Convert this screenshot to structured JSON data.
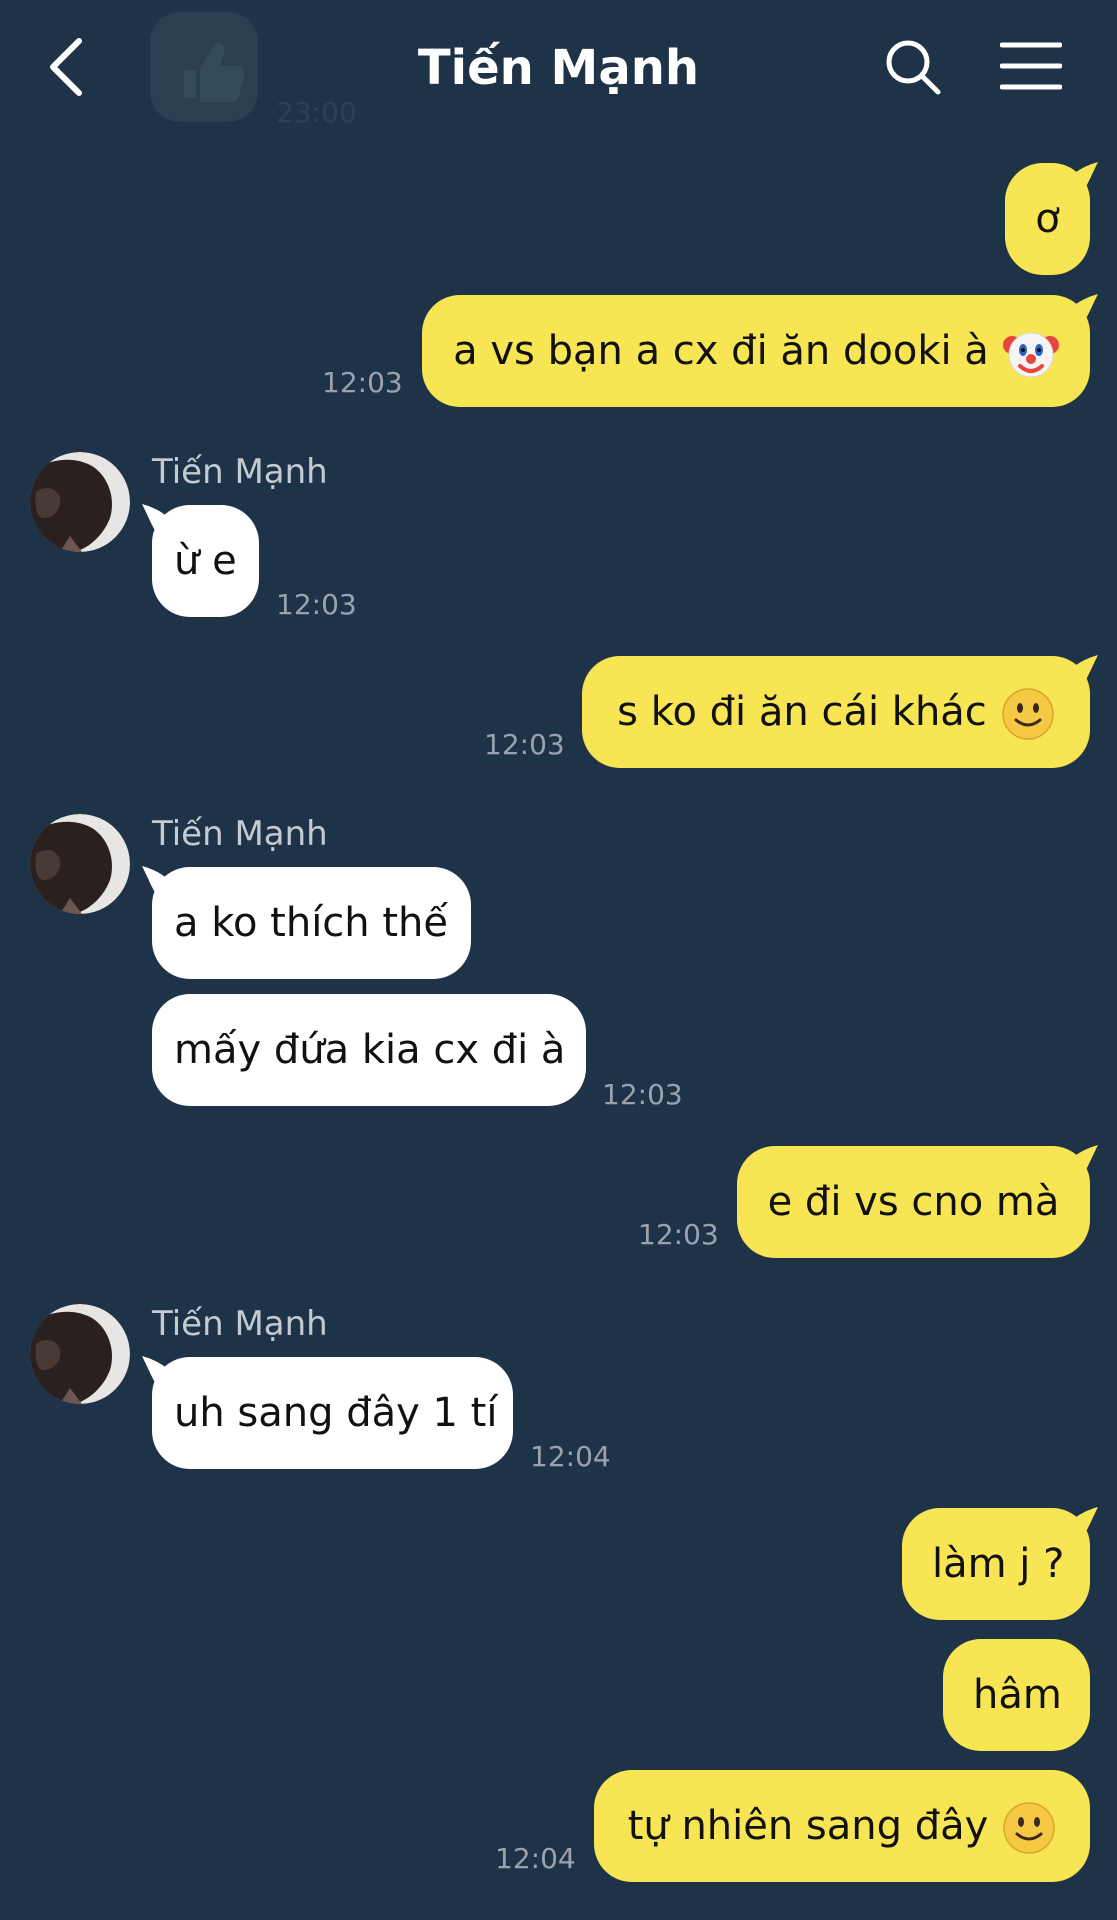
{
  "header": {
    "title": "Tiến Mạnh",
    "back_icon": "chevron-left-icon",
    "search_icon": "search-icon",
    "menu_icon": "hamburger-menu-icon"
  },
  "colors": {
    "background": "#1e3347",
    "my_bubble": "#f7e553",
    "their_bubble": "#ffffff",
    "timestamp": "#9aa3ad",
    "sender_name": "#c4cad1"
  },
  "ghost": {
    "time": "23:00",
    "icon": "thumbs-up-icon"
  },
  "messages": {
    "m1": {
      "text": "ơ"
    },
    "m2": {
      "text": "a vs bạn a cx đi ăn dooki à",
      "emoji": "clown-face-icon",
      "time": "12:03"
    },
    "m3": {
      "sender": "Tiến Mạnh",
      "text": "ừ e",
      "time": "12:03"
    },
    "m4": {
      "text": "s ko đi ăn cái khác",
      "emoji": "smiling-face-icon",
      "time": "12:03"
    },
    "m5": {
      "sender": "Tiến Mạnh",
      "text": "a ko thích thế"
    },
    "m6": {
      "text": "mấy đứa kia cx đi à",
      "time": "12:03"
    },
    "m7": {
      "text": "e đi vs cno mà",
      "time": "12:03"
    },
    "m8": {
      "sender": "Tiến Mạnh",
      "text": "uh sang đây 1 tí",
      "time": "12:04"
    },
    "m9": {
      "text": "làm j ?"
    },
    "m10": {
      "text": "hâm"
    },
    "m11": {
      "text": "tự nhiên sang đây",
      "emoji": "smiling-face-icon",
      "time": "12:04"
    }
  }
}
